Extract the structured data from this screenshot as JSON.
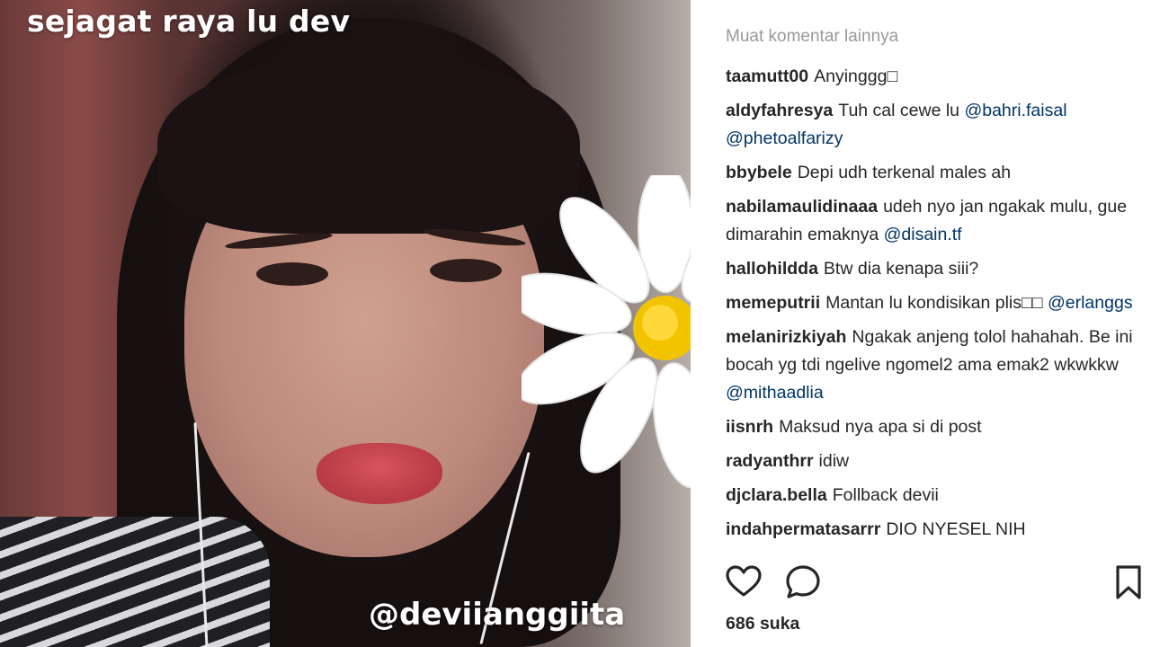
{
  "post": {
    "caption_top": "sejagat raya lu dev",
    "caption_bottom": "@deviianggiita"
  },
  "comments_panel": {
    "load_more": "Muat komentar lainnya",
    "items": [
      {
        "user": "taamutt00",
        "text": "Anyinggg□",
        "mention": ""
      },
      {
        "user": "aldyfahresya",
        "text": "Tuh cal cewe lu",
        "mention": "@bahri.faisal @phetoalfarizy"
      },
      {
        "user": "bbybele",
        "text": "Depi udh terkenal males ah",
        "mention": ""
      },
      {
        "user": "nabilamaulidinaaa",
        "text": "udeh nyo jan ngakak mulu, gue dimarahin emaknya",
        "mention": "@disain.tf"
      },
      {
        "user": "hallohildda",
        "text": "Btw dia kenapa siii?",
        "mention": ""
      },
      {
        "user": "memeputrii",
        "text": "Mantan lu kondisikan plis□□",
        "mention": "@erlanggs"
      },
      {
        "user": "melanirizkiyah",
        "text": "Ngakak anjeng tolol hahahah. Be ini bocah yg tdi ngelive ngomel2 ama emak2 wkwkkw",
        "mention": "@mithaadlia"
      },
      {
        "user": "iisnrh",
        "text": "Maksud nya apa si di post",
        "mention": ""
      },
      {
        "user": "radyanthrr",
        "text": "idiw",
        "mention": ""
      },
      {
        "user": "djclara.bella",
        "text": "Follback devii",
        "mention": ""
      },
      {
        "user": "indahpermatasarrr",
        "text": "DIO NYESEL NIH",
        "mention": ""
      }
    ]
  },
  "actions": {
    "like_icon": "heart-icon",
    "comment_icon": "comment-bubble-icon",
    "save_icon": "bookmark-icon",
    "likes_count": "686 suka"
  },
  "colors": {
    "mention": "#003569",
    "muted": "#999999",
    "text": "#262626"
  }
}
